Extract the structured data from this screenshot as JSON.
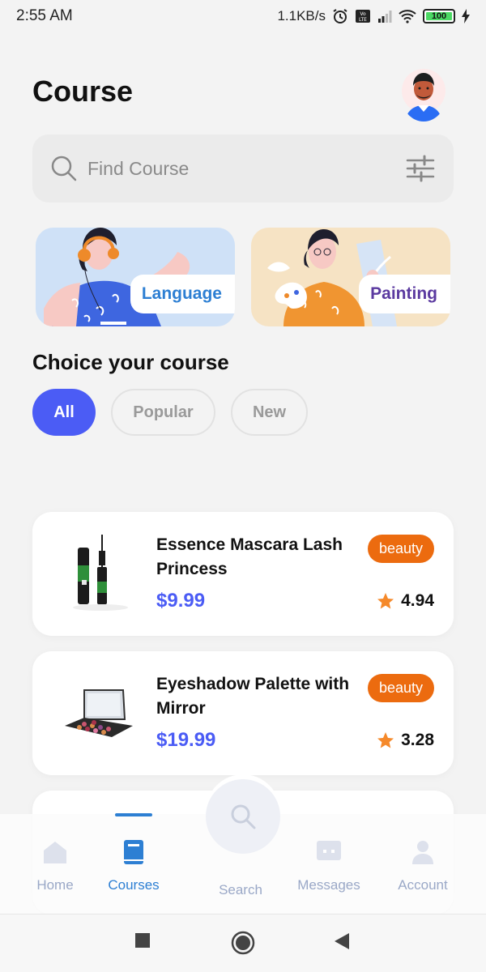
{
  "status_bar": {
    "time": "2:55 AM",
    "net_speed": "1.1KB/s",
    "battery": "100",
    "icons": [
      "alarm-icon",
      "volte-icon",
      "signal-icon",
      "wifi-icon",
      "battery-icon",
      "charging-icon"
    ]
  },
  "header": {
    "title": "Course"
  },
  "search": {
    "placeholder": "Find Course"
  },
  "categories": [
    {
      "label": "Language"
    },
    {
      "label": "Painting"
    }
  ],
  "section": {
    "title": "Choice your course"
  },
  "filters": [
    {
      "label": "All",
      "active": true
    },
    {
      "label": "Popular",
      "active": false
    },
    {
      "label": "New",
      "active": false
    }
  ],
  "courses": [
    {
      "title": "Essence Mascara Lash Princess",
      "price": "$9.99",
      "tag": "beauty",
      "rating": "4.94"
    },
    {
      "title": "Eyeshadow Palette with Mirror",
      "price": "$19.99",
      "tag": "beauty",
      "rating": "3.28"
    }
  ],
  "bottom_nav": [
    {
      "label": "Home"
    },
    {
      "label": "Courses"
    },
    {
      "label": "Search"
    },
    {
      "label": "Messages"
    },
    {
      "label": "Account"
    }
  ],
  "colors": {
    "accent": "#4b5cf5",
    "tag": "#ec6b0f",
    "nav_active": "#2d7fd3",
    "star": "#f5892a"
  }
}
